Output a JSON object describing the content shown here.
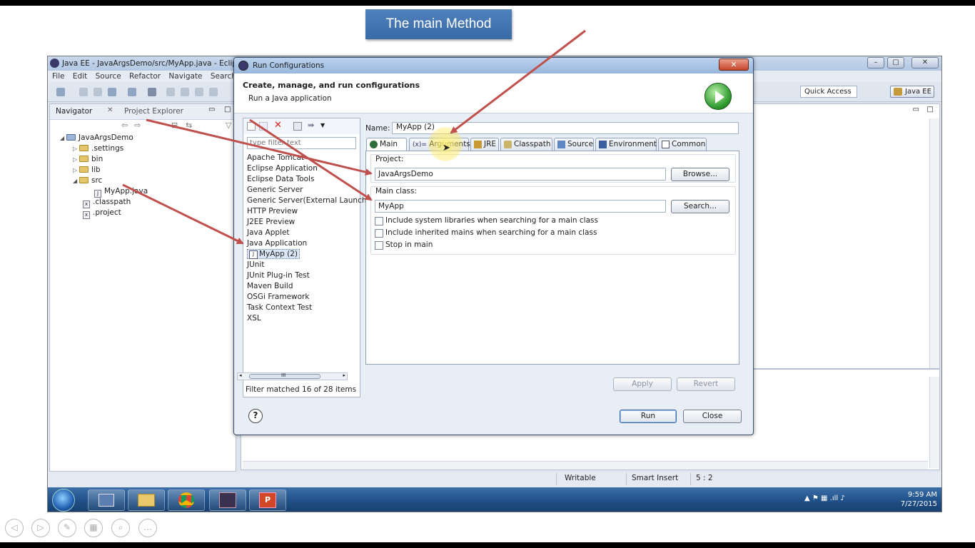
{
  "slide": {
    "title": "The main Method"
  },
  "eclipse": {
    "title": "Java EE - JavaArgsDemo/src/MyApp.java - Eclipse",
    "menu": [
      "File",
      "Edit",
      "Source",
      "Refactor",
      "Navigate",
      "Search"
    ],
    "quick_access": "Quick Access",
    "perspective": "Java EE",
    "navigator": {
      "tabs": [
        "Navigator",
        "Project Explorer"
      ],
      "tree": [
        {
          "label": "JavaArgsDemo",
          "kind": "project"
        },
        {
          "label": ".settings",
          "kind": "folder"
        },
        {
          "label": "bin",
          "kind": "folder"
        },
        {
          "label": "lib",
          "kind": "folder"
        },
        {
          "label": "src",
          "kind": "folder"
        },
        {
          "label": "MyApp.java",
          "kind": "file"
        },
        {
          "label": ".classpath",
          "kind": "file"
        },
        {
          "label": ".project",
          "kind": "file"
        }
      ]
    },
    "status": {
      "writable": "Writable",
      "insert": "Smart Insert",
      "position": "5 : 2"
    },
    "clock": {
      "time": "9:59 AM",
      "date": "7/27/2015"
    }
  },
  "dialog": {
    "title": "Run Configurations",
    "close_label": "✕",
    "header_title": "Create, manage, and run configurations",
    "header_subtitle": "Run a Java application",
    "filter_placeholder": "type filter text",
    "configs": [
      "Apache Tomcat",
      "Eclipse Application",
      "Eclipse Data Tools",
      "Generic Server",
      "Generic Server(External Launch)",
      "HTTP Preview",
      "J2EE Preview",
      "Java Applet",
      "Java Application",
      "MyApp (2)",
      "JUnit",
      "JUnit Plug-in Test",
      "Maven Build",
      "OSGi Framework",
      "Task Context Test",
      "XSL"
    ],
    "scroll_grip": "III",
    "filter_status": "Filter matched 16 of 28 items",
    "name_label": "Name:",
    "name_value": "MyApp (2)",
    "tabs": [
      "Main",
      "Arguments",
      "JRE",
      "Classpath",
      "Source",
      "Environment",
      "Common"
    ],
    "arguments_prefix": "(x)=",
    "project_label": "Project:",
    "project_value": "JavaArgsDemo",
    "browse_label": "Browse...",
    "main_class_label": "Main class:",
    "main_class_value": "MyApp",
    "search_label": "Search...",
    "checkboxes": [
      "Include system libraries when searching for a main class",
      "Include inherited mains when searching for a main class",
      "Stop in main"
    ],
    "apply_label": "Apply",
    "revert_label": "Revert",
    "run_label": "Run",
    "close_button_label": "Close",
    "help_symbol": "?"
  },
  "colors": {
    "annotation_arrow": "#c0504d",
    "title_box": "#4f81bd"
  }
}
